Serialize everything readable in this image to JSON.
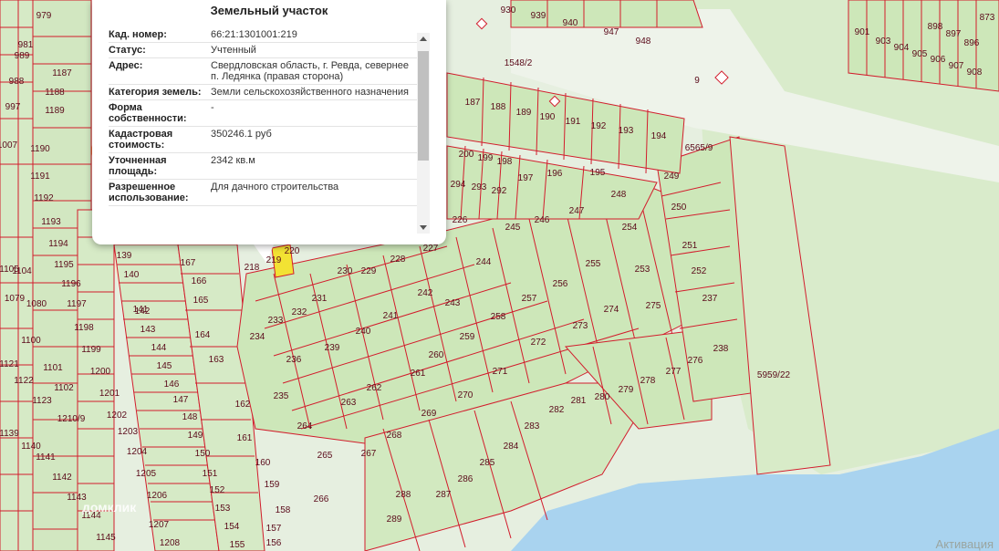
{
  "popup": {
    "title": "Земельный участок",
    "rows": [
      {
        "label": "Кад. номер:",
        "value": "66:21:1301001:219"
      },
      {
        "label": "Статус:",
        "value": "Учтенный"
      },
      {
        "label": "Адрес:",
        "value": "Свердловская область, г. Ревда, севернее п. Ледянка (правая сторона)"
      },
      {
        "label": "Категория земель:",
        "value": "Земли сельскохозяйственного назначения"
      },
      {
        "label": "Форма собственности:",
        "value": "-"
      },
      {
        "label": "Кадастровая стоимость:",
        "value": "350246.1 руб"
      },
      {
        "label": "Уточненная площадь:",
        "value": "2342 кв.м"
      },
      {
        "label": "Разрешенное использование:",
        "value": "Для дачного строительства"
      }
    ]
  },
  "watermark": {
    "brand": "домклик",
    "activation": "Активация"
  },
  "map": {
    "parcel_labels": [
      "1548/2",
      "940",
      "947",
      "948",
      "939",
      "930",
      "901",
      "903",
      "904",
      "905",
      "906",
      "907",
      "908",
      "897",
      "898",
      "896",
      "873",
      "187",
      "188",
      "189",
      "190",
      "191",
      "192",
      "193",
      "194",
      "200",
      "199",
      "198",
      "197",
      "196",
      "195",
      "249",
      "250",
      "251",
      "252",
      "237",
      "238",
      "275",
      "276",
      "277",
      "278",
      "279",
      "280",
      "281",
      "282",
      "283",
      "284",
      "285",
      "286",
      "287",
      "288",
      "289",
      "5959/22",
      "6565/9",
      "9",
      "294",
      "293",
      "292",
      "226",
      "227",
      "228",
      "229",
      "230",
      "231",
      "232",
      "233",
      "234",
      "235",
      "236",
      "239",
      "240",
      "241",
      "242",
      "243",
      "244",
      "245",
      "246",
      "247",
      "248",
      "253",
      "254",
      "255",
      "256",
      "257",
      "258",
      "259",
      "260",
      "261",
      "262",
      "263",
      "264",
      "265",
      "266",
      "267",
      "268",
      "269",
      "270",
      "271",
      "272",
      "273",
      "274",
      "218",
      "219",
      "220",
      "139",
      "140",
      "141",
      "142",
      "143",
      "144",
      "145",
      "146",
      "147",
      "148",
      "149",
      "150",
      "151",
      "152",
      "153",
      "154",
      "155",
      "156",
      "157",
      "158",
      "159",
      "160",
      "161",
      "162",
      "163",
      "164",
      "165",
      "166",
      "167",
      "1187",
      "1188",
      "1189",
      "1190",
      "1191",
      "1192",
      "1193",
      "1194",
      "1195",
      "1196",
      "1197",
      "1198",
      "1199",
      "1200",
      "1201",
      "1202",
      "1203",
      "1204",
      "1205",
      "1206",
      "1207",
      "1208",
      "1210/9",
      "1100",
      "1101",
      "1102",
      "1121",
      "1122",
      "1123",
      "1139",
      "1140",
      "1141",
      "1142",
      "1143",
      "1144",
      "1145",
      "1079",
      "1080",
      "1104",
      "1105",
      "1007",
      "997",
      "988",
      "989",
      "981",
      "979"
    ]
  },
  "colors": {
    "parcel_fill": "#cfe8bd",
    "parcel_border": "#d21c2c",
    "water": "#a9d3ef",
    "selected": "#f2e233"
  }
}
